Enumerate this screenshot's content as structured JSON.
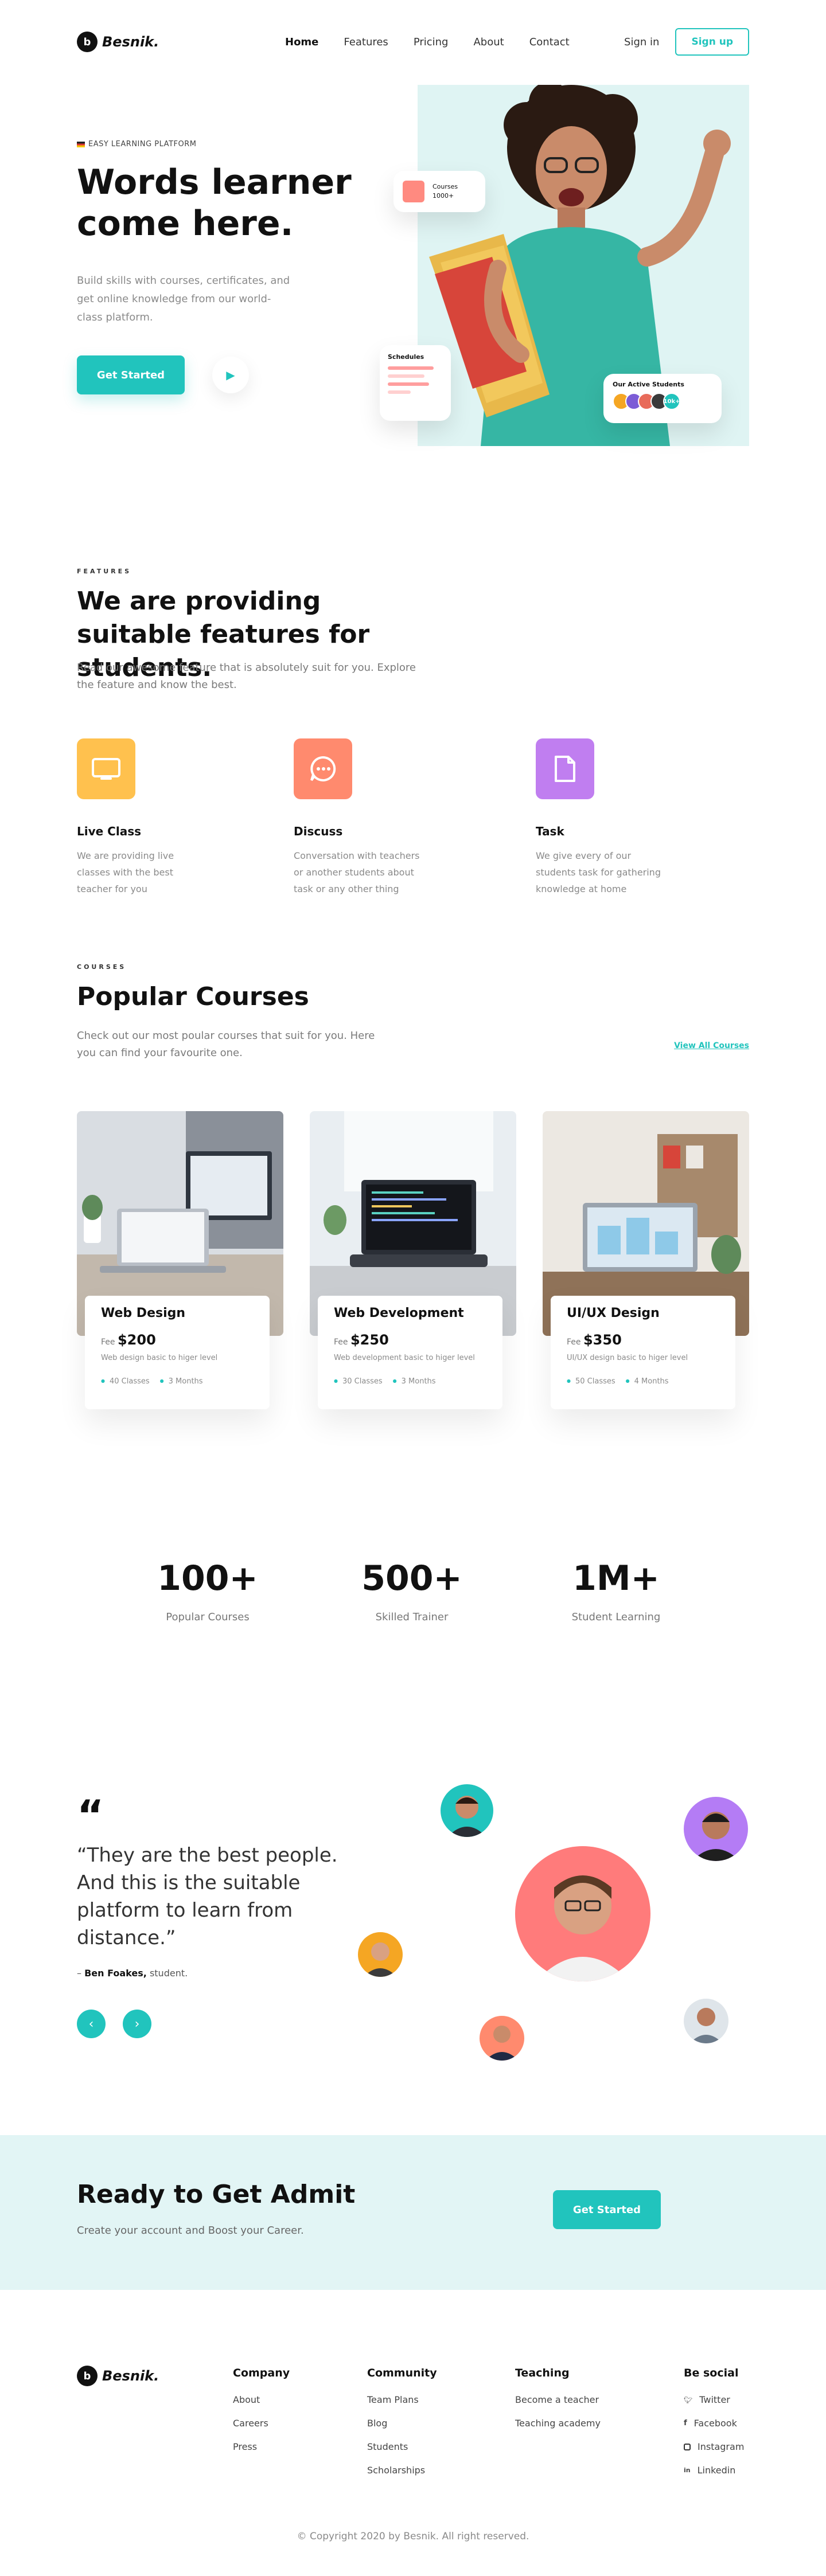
{
  "brand": {
    "name": "Besnik.",
    "mark": "b"
  },
  "nav": {
    "links": [
      "Home",
      "Features",
      "Pricing",
      "About",
      "Contact"
    ],
    "signin": "Sign in",
    "signup": "Sign up"
  },
  "hero": {
    "tag": "EASY LEARNING PLATFORM",
    "title": "Words learner come here.",
    "subtitle": "Build skills with courses, certificates, and get online knowledge from our world-class platform.",
    "cta": "Get Started",
    "cards": {
      "courses_label": "Courses",
      "courses_count": "1000+",
      "schedules_label": "Schedules",
      "students_label": "Our Active Students",
      "students_more": "10k+"
    }
  },
  "features": {
    "eyebrow": "FEATURES",
    "title": "We are providing suitable features for students.",
    "subtitle": "Read our awesome feature that is absolutely suit for you. Explore the feature and know the best.",
    "items": [
      {
        "name": "Live Class",
        "desc": "We are providing live classes with the best teacher for you",
        "icon": "monitor-icon",
        "color": "#ffc14e"
      },
      {
        "name": "Discuss",
        "desc": "Conversation with teachers or another students about task or any other thing",
        "icon": "chat-icon",
        "color": "#ff8a6e"
      },
      {
        "name": "Task",
        "desc": "We give every of our students task for gathering knowledge at home",
        "icon": "document-icon",
        "color": "#c07ef0"
      }
    ]
  },
  "courses": {
    "eyebrow": "COURSES",
    "title": "Popular Courses",
    "subtitle": "Check out our most poular courses that suit for you. Here you can find your favourite one.",
    "view_all": "View All Courses",
    "fee_label": "Fee",
    "items": [
      {
        "title": "Web Design",
        "price": "$200",
        "desc": "Web design basic to higer level",
        "classes": "40 Classes",
        "months": "3 Months"
      },
      {
        "title": "Web Development",
        "price": "$250",
        "desc": "Web development basic to higer level",
        "classes": "30 Classes",
        "months": "3 Months"
      },
      {
        "title": "UI/UX Design",
        "price": "$350",
        "desc": "UI/UX design basic to higer level",
        "classes": "50 Classes",
        "months": "4 Months"
      }
    ]
  },
  "stats": [
    {
      "value": "100+",
      "label": "Popular Courses"
    },
    {
      "value": "500+",
      "label": "Skilled Trainer"
    },
    {
      "value": "1M+",
      "label": "Student Learning"
    }
  ],
  "testimonial": {
    "mark": "“",
    "quote": "“They are the best people. And this is the suitable platform to learn from distance.”",
    "author": "Ben Foakes,",
    "role": "student.",
    "prefix": "–"
  },
  "cta": {
    "title": "Ready to Get Admit",
    "subtitle": "Create your account and Boost your Career.",
    "button": "Get Started"
  },
  "footer": {
    "columns": [
      {
        "heading": "Company",
        "items": [
          "About",
          "Careers",
          "Press"
        ]
      },
      {
        "heading": "Community",
        "items": [
          "Team Plans",
          "Blog",
          "Students",
          "Scholarships"
        ]
      },
      {
        "heading": "Teaching",
        "items": [
          "Become a teacher",
          "Teaching academy"
        ]
      }
    ],
    "social": {
      "heading": "Be social",
      "items": [
        "Twitter",
        "Facebook",
        "Instagram",
        "Linkedin"
      ]
    },
    "copyright": "© Copyright 2020 by Besnik. All right reserved."
  },
  "colors": {
    "accent": "#21c4bd",
    "mint_bg": "#e2f5f5",
    "hero_bg": "#dff4f3"
  }
}
